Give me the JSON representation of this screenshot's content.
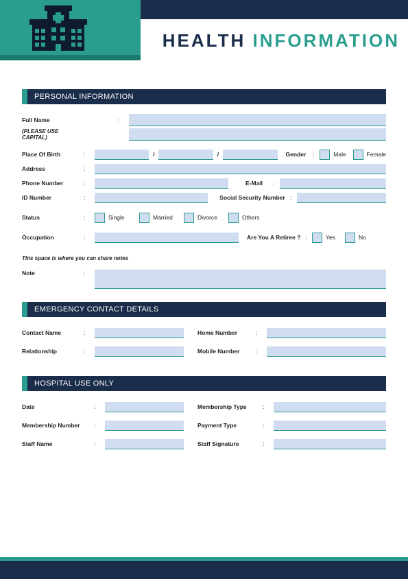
{
  "title": {
    "part1": "HEALTH",
    "part2": "INFORMATION"
  },
  "sections": {
    "personal": "PERSONAL INFORMATION",
    "emergency": "EMERGENCY CONTACT DETAILS",
    "hospital": "HOSPITAL USE ONLY"
  },
  "personal": {
    "full_name": "Full Name",
    "capital_note": "(PLEASE USE CAPITAL)",
    "pob": "Place Of Birth",
    "gender": "Gender",
    "address": "Address",
    "phone": "Phone Number",
    "email": "E-Mail",
    "id": "ID Number",
    "ssn": "Social Security Number",
    "status": "Status",
    "occupation": "Occupation",
    "retiree_q": "Are You A Retiree ?",
    "notes_hint": "This space is where you can share notes",
    "note": "Note"
  },
  "options": {
    "male": "Male",
    "female": "Female",
    "single": "Single",
    "married": "Married",
    "divorce": "Divorce",
    "others": "Others",
    "yes": "Yes",
    "no": "No"
  },
  "emergency": {
    "contact_name": "Contact Name",
    "home_number": "Home Number",
    "relationship": "Relationship",
    "mobile_number": "Mobile Number"
  },
  "hospital": {
    "date": "Date",
    "membership_type": "Membership Type",
    "membership_number": "Membership Number",
    "payment_type": "Payment Type",
    "staff_name": "Staff Name",
    "staff_signature": "Staff Signature"
  },
  "sep": "/",
  "colon": ":"
}
